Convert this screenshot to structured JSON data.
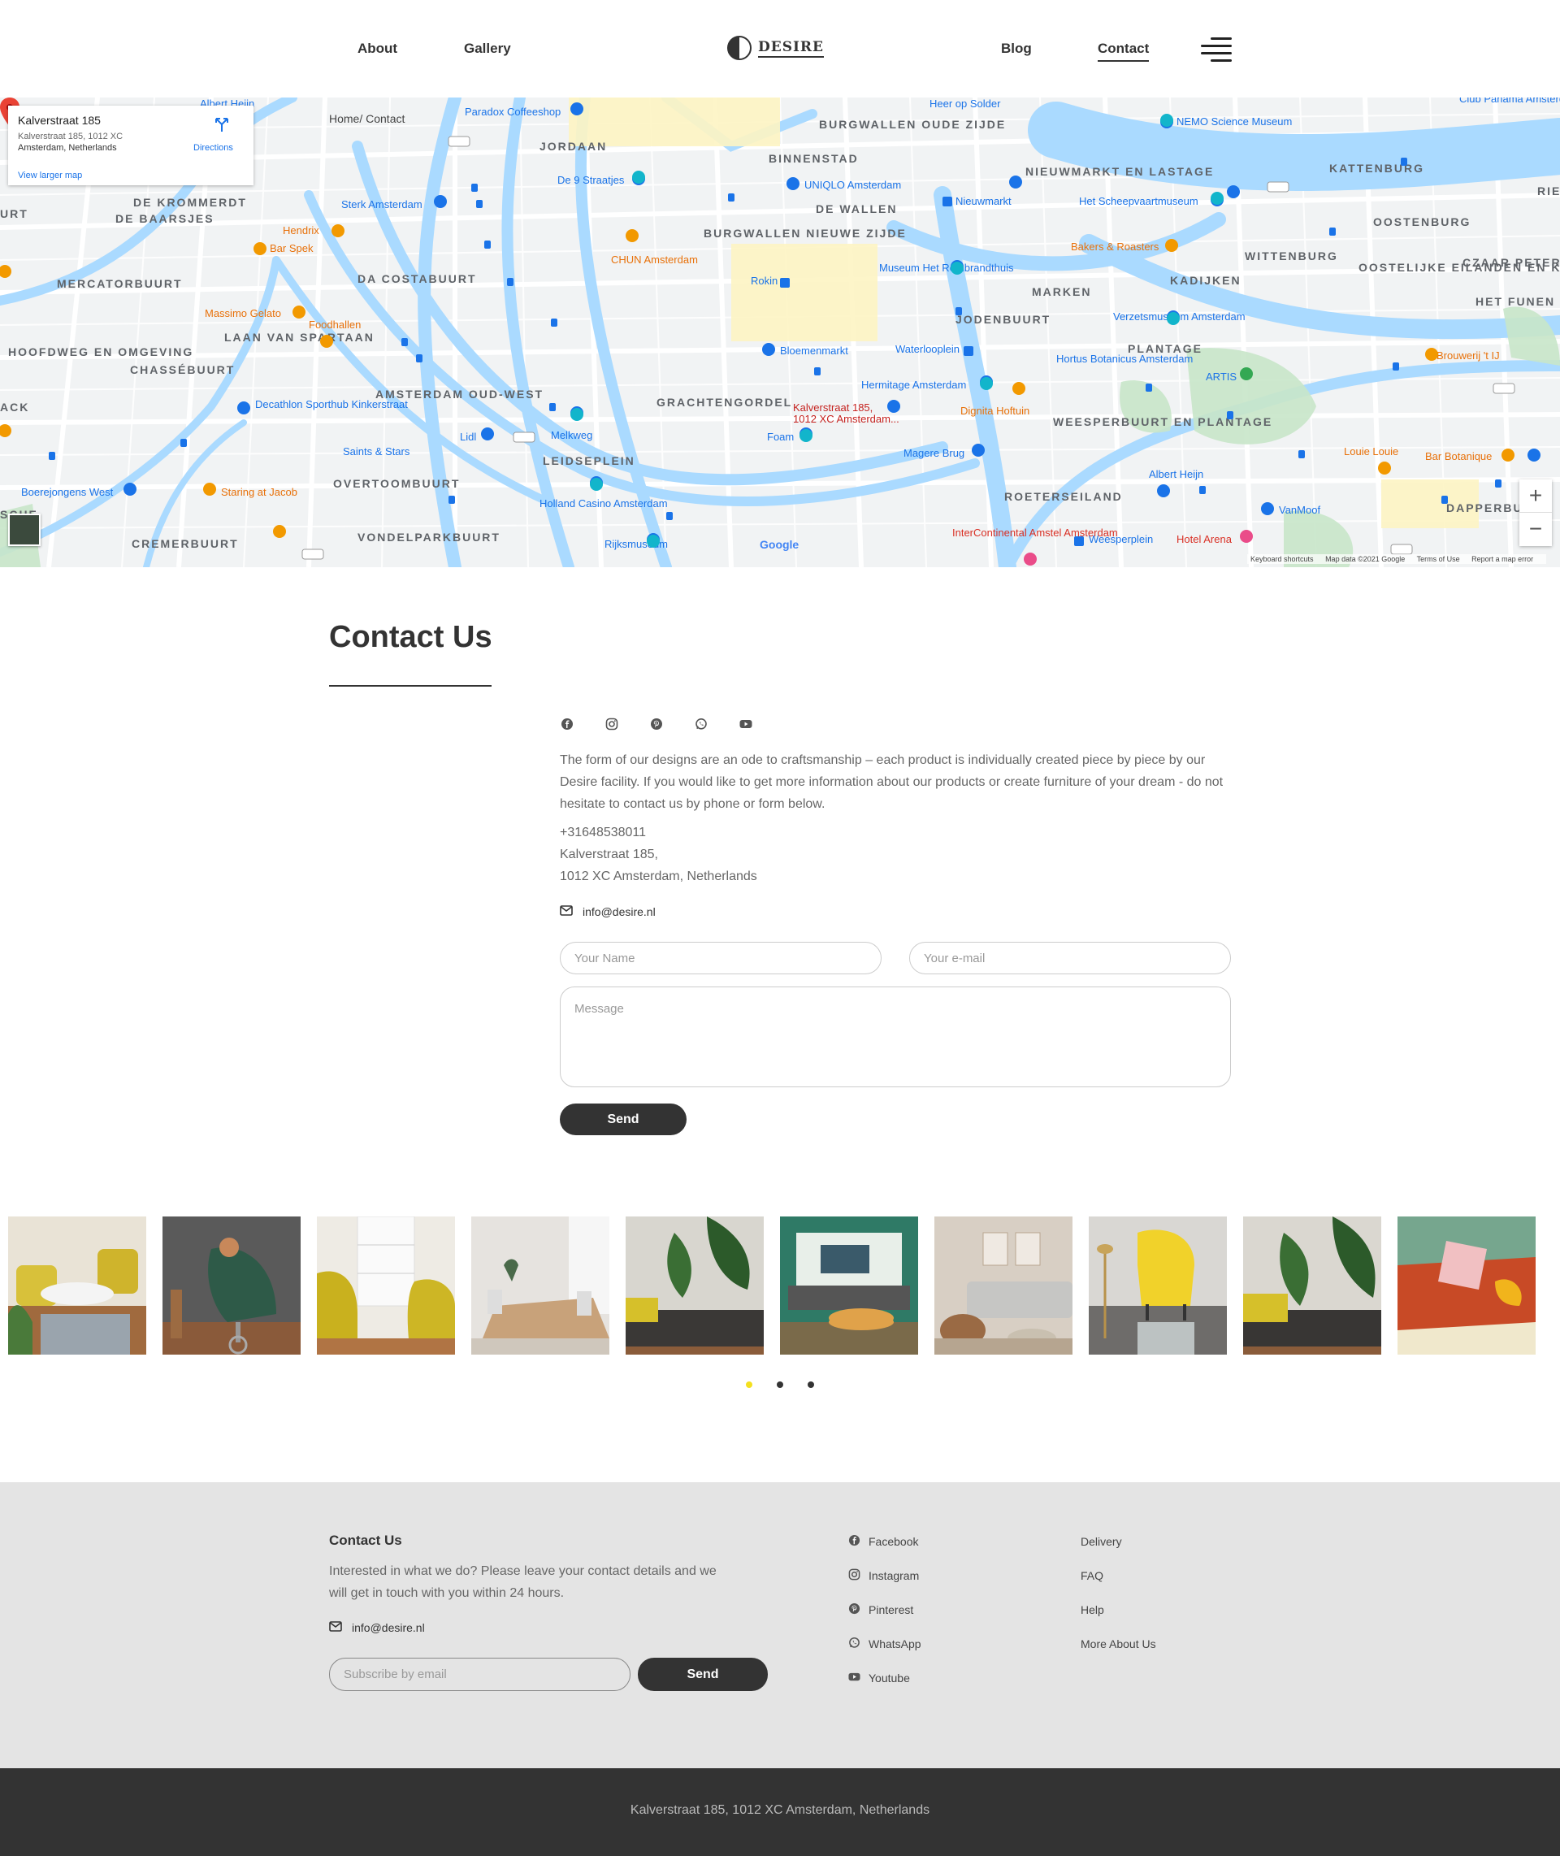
{
  "header": {
    "nav_left": [
      "About",
      "Gallery"
    ],
    "logo_text": "DESIRE",
    "nav_right": [
      "Blog",
      "Contact"
    ],
    "active": "Contact",
    "menu_icon": "hamburger-icon"
  },
  "map": {
    "card_title": "Kalverstraat 185",
    "card_address_line1": "Kalverstraat 185, 1012 XC",
    "card_address_line2": "Amsterdam, Netherlands",
    "directions_label": "Directions",
    "view_larger": "View larger map",
    "breadcrumb": "Home/ Contact",
    "pin_label_line1": "Kalverstraat 185,",
    "pin_label_line2": "1012 XC Amsterdam...",
    "google": "Google",
    "footer_links": [
      "Keyboard shortcuts",
      "Map data ©2021 Google",
      "Terms of Use",
      "Report a map error"
    ],
    "places": [
      "JORDAAN",
      "BINNENSTAD",
      "BURGWALLEN OUDE ZIJDE",
      "NIEUWMARKT EN LASTAGE",
      "KATTENBURG",
      "OOSTENBURG",
      "WITTENBURG",
      "CZAAR PETERBURUT",
      "OOSTELIJKE EILANDEN EN KADIJKEN",
      "KADIJKEN",
      "MARKEN",
      "JODENBUURT",
      "PLANTAGE",
      "DE WALLEN",
      "BURGWALLEN NIEUWE ZIJDE",
      "DA COSTABUURT",
      "MERCATORBUURT",
      "DE KROMMERDT",
      "DE BAARSJES",
      "CHASSÉBUURT",
      "AMSTERDAM OUD-WEST",
      "HOOFDWEG EN OMGEVING",
      "GRACHTENGORDEL",
      "LEIDSEPLEIN",
      "OVERTOOMBUURT",
      "VONDELPARKBUURT",
      "CREMERBUURT",
      "WEESPERBUURT EN PLANTAGE",
      "ROETERSEILAND",
      "DAPPERBUURT",
      "HET FUNEN",
      "LAAN VAN SPARTAAN",
      "RIE",
      "URT",
      "ACK",
      "SCHE"
    ],
    "pois": [
      "Paradox Coffeeshop",
      "NEMO Science Museum",
      "De 9 Straatjes",
      "UNIQLO Amsterdam",
      "Sterk Amsterdam",
      "Hendrix",
      "Bar Spek",
      "CHUN Amsterdam",
      "Nieuwmarkt",
      "Het Scheepvaartmuseum",
      "Bakers & Roasters",
      "Rokin",
      "Museum Het Rembrandthuis",
      "Massimo Gelato",
      "Foodhallen",
      "Verzetsmuseum Amsterdam",
      "Bloemenmarkt",
      "Waterlooplein",
      "Hortus Botanicus Amsterdam",
      "ARTIS",
      "Brouwerij 't IJ",
      "Decathlon Sporthub Kinkerstraat",
      "Hermitage Amsterdam",
      "Dignita Hoftuin",
      "Melkweg",
      "Lidl",
      "Saints & Stars",
      "Foam",
      "Magere Brug",
      "Louie Louie",
      "Bar Botanique",
      "Boerejongens West",
      "Staring at Jacob",
      "Holland Casino Amsterdam",
      "Albert Heijn",
      "VanMoof",
      "Rijksmuseum",
      "InterContinental Amstel Amsterdam",
      "Weesperplein",
      "Hotel Arena",
      "Heer op Solder",
      "Albert Heijn",
      "Club Panama Amsterdam"
    ]
  },
  "contact": {
    "title": "Contact Us",
    "socials": [
      "facebook-icon",
      "instagram-icon",
      "pinterest-icon",
      "whatsapp-icon",
      "youtube-icon"
    ],
    "description": "The form of our designs are an ode to craftsmanship – each product is individually created piece by piece by our Desire facility. If you would like to get more information about our products or create furniture of your dream - do not hesitate to contact us by phone or form below.",
    "phone": "+31648538011",
    "address_line1": "Kalverstraat 185,",
    "address_line2": "1012 XC Amsterdam, Netherlands",
    "email": "info@desire.nl",
    "name_placeholder": "Your Name",
    "email_placeholder": "Your e-mail",
    "message_placeholder": "Message",
    "send_label": "Send"
  },
  "gallery": {
    "tiles": [
      "yellow-armchair-living-room",
      "green-leather-chair",
      "yellow-chairs-shelf",
      "dining-table-room",
      "plant-sofa-yellow-chair",
      "living-room-tropical-wall",
      "grey-sofa-living-room",
      "yellow-armchair-floor-lamp",
      "plant-sofa-yellow-chair-2",
      "orange-sofa-pink-pillow"
    ],
    "pages": 3,
    "active_page": 1
  },
  "footer": {
    "title": "Contact Us",
    "description": "Interested in what we do? Please leave your contact details and we will get in touch with you within 24 hours.",
    "email": "info@desire.nl",
    "subscribe_placeholder": "Subscribe by email",
    "send_label": "Send",
    "social_links": [
      {
        "label": "Facebook",
        "icon": "facebook-icon"
      },
      {
        "label": "Instagram",
        "icon": "instagram-icon"
      },
      {
        "label": "Pinterest",
        "icon": "pinterest-icon"
      },
      {
        "label": "WhatsApp",
        "icon": "whatsapp-icon"
      },
      {
        "label": "Youtube",
        "icon": "youtube-icon"
      }
    ],
    "info_links": [
      "Delivery",
      "FAQ",
      "Help",
      "More About Us"
    ],
    "bottom_address": "Kalverstraat 185, 1012 XC Amsterdam, Netherlands"
  },
  "colors": {
    "accent_dot": "#f4e01e",
    "dark": "#333333",
    "footer_bg": "#e4e4e4",
    "water": "#aadaff",
    "map_pin": "#ea4335"
  }
}
